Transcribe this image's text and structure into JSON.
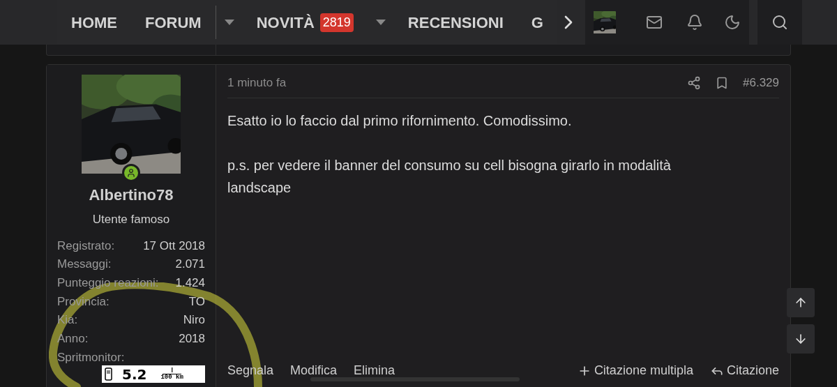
{
  "nav": {
    "items": [
      {
        "label": "HOME",
        "dropdown": false
      },
      {
        "label": "FORUM",
        "dropdown": true
      },
      {
        "label": "NOVITÀ",
        "badge": "2819",
        "dropdown": true
      },
      {
        "label": "RECENSIONI",
        "dropdown": false
      },
      {
        "label": "G",
        "dropdown": false
      }
    ]
  },
  "post": {
    "user": {
      "name": "Albertino78",
      "title": "Utente famoso",
      "online": true,
      "stats": [
        {
          "label": "Registrato:",
          "value": "17 Ott 2018"
        },
        {
          "label": "Messaggi:",
          "value": "2.071"
        },
        {
          "label": "Punteggio reazioni:",
          "value": "1.424"
        },
        {
          "label": "Provincia:",
          "value": "TO"
        },
        {
          "label": "Kia:",
          "value": "Niro"
        },
        {
          "label": "Anno:",
          "value": "2018"
        },
        {
          "label": "Spritmonitor:"
        }
      ],
      "banner": {
        "value": "5.2",
        "unit_top": "l",
        "unit_bottom": "100 km"
      }
    },
    "time": "1 minuto fa",
    "number": "#6.329",
    "paragraphs": [
      "Esatto io lo faccio dal primo rifornimento. Comodissimo.",
      "p.s. per vedere il banner del consumo su cell bisogna girarlo in modalità landscape"
    ],
    "actions_left": [
      "Segnala",
      "Modifica",
      "Elimina"
    ],
    "actions_right": [
      {
        "label": "Citazione multipla",
        "kind": "plus"
      },
      {
        "label": "Citazione",
        "kind": "reply"
      }
    ]
  }
}
